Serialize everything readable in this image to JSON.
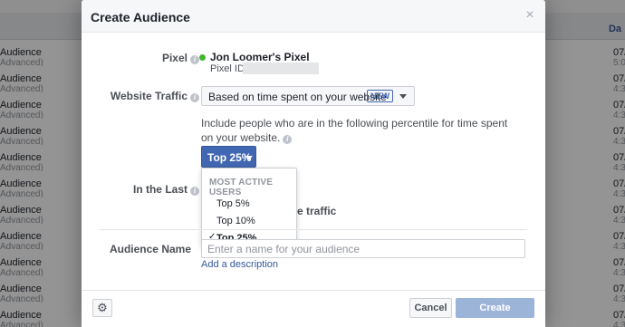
{
  "background": {
    "column_header": "Da",
    "rows": [
      {
        "title": "Audience",
        "sub": "Advanced)",
        "r1": "07/",
        "r2": "5:0"
      },
      {
        "title": "Audience",
        "sub": "Advanced)",
        "r1": "07/",
        "r2": "4:3"
      },
      {
        "title": "Audience",
        "sub": "Advanced)",
        "r1": "07/",
        "r2": "4:3"
      },
      {
        "title": "Audience",
        "sub": "Advanced)",
        "r1": "07/",
        "r2": "4:3"
      },
      {
        "title": "Audience",
        "sub": "Advanced)",
        "r1": "07/",
        "r2": "4:3"
      },
      {
        "title": "Audience",
        "sub": "Advanced)",
        "r1": "07/",
        "r2": "4:3"
      },
      {
        "title": "Audience",
        "sub": "Advanced)",
        "r1": "07/",
        "r2": "4:3"
      },
      {
        "title": "Audience",
        "sub": "Advanced)",
        "r1": "07/",
        "r2": "4:3"
      },
      {
        "title": "Audience",
        "sub": "Advanced)",
        "r1": "07/",
        "r2": "4:3"
      },
      {
        "title": "Audience",
        "sub": "Advanced)",
        "r1": "07/",
        "r2": "4:3"
      },
      {
        "title": "Audience",
        "sub": "Advanced)",
        "r1": "07/",
        "r2": "4:3"
      }
    ]
  },
  "dialog": {
    "title": "Create Audience",
    "close_icon": "×",
    "pixel": {
      "label": "Pixel",
      "name": "Jon Loomer's Pixel",
      "id_label": "Pixel ID:",
      "status_color": "#42b72a"
    },
    "website_traffic": {
      "label": "Website Traffic",
      "selected": "Based on time spent on your website",
      "badge": "NEW"
    },
    "percentile_description": "Include people who are in the following percentile for time spent on your website.",
    "percentile_button": "Top 25%",
    "menu": {
      "heading": "MOST ACTIVE USERS",
      "items": [
        "Top 5%",
        "Top 10%",
        "Top 25%"
      ],
      "selected_index": 2
    },
    "in_the_last_label": "In the Last",
    "traffic_tail": "e traffic",
    "audience_name": {
      "label": "Audience Name",
      "placeholder": "Enter a name for your audience"
    },
    "add_description": "Add a description",
    "footer": {
      "cancel": "Cancel",
      "create": "Create Audience",
      "gear_icon": "⚙"
    }
  }
}
